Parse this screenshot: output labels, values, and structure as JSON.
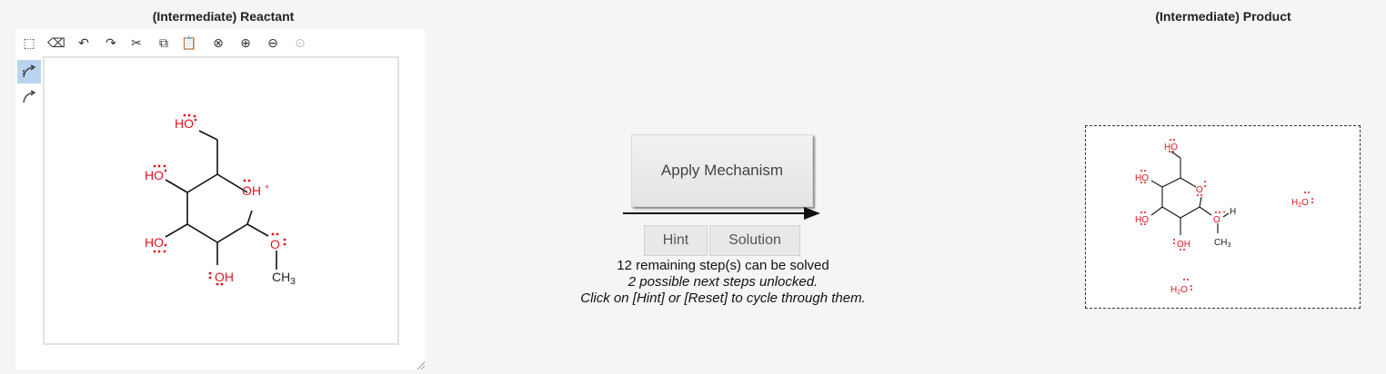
{
  "reactant": {
    "title": "(Intermediate) Reactant"
  },
  "product": {
    "title": "(Intermediate) Product"
  },
  "toolbar": [
    {
      "name": "select-tool-icon",
      "glyph": "⬚"
    },
    {
      "name": "eraser-icon",
      "glyph": "⌫"
    },
    {
      "name": "undo-icon",
      "glyph": "↶"
    },
    {
      "name": "redo-icon",
      "glyph": "↷"
    },
    {
      "name": "cut-icon",
      "glyph": "✂"
    },
    {
      "name": "copy-icon",
      "glyph": "⧉"
    },
    {
      "name": "paste-icon",
      "glyph": "📋"
    },
    {
      "name": "zoom-reset-icon",
      "glyph": "⊗"
    },
    {
      "name": "zoom-in-icon",
      "glyph": "⊕"
    },
    {
      "name": "zoom-out-icon",
      "glyph": "⊖"
    },
    {
      "name": "zoom-fit-icon",
      "glyph": "⊙"
    }
  ],
  "reactant_molecule": {
    "labels": {
      "ho_top": "HO",
      "ho_left_upper": "HO",
      "ho_left_lower": "HO",
      "oh_plus": "OH",
      "plus": "+",
      "o_methoxy": "O",
      "oh_bottom": "OH",
      "ch3": "CH",
      "ch3_sub": "3"
    }
  },
  "product_molecule": {
    "labels": {
      "ho_top": "HO",
      "ho_left_upper": "HO",
      "ho_left_lower": "HO",
      "o_ring": "O",
      "o_plus": "O",
      "plus": "+",
      "h": "H",
      "oh_bottom": "OH",
      "ch3": "CH",
      "ch3_sub": "3",
      "water1_h": "H",
      "water1_sub": "2",
      "water1_o": "O",
      "water2_h": "H",
      "water2_sub": "2",
      "water2_o": "O"
    }
  },
  "actions": {
    "apply_label": "Apply Mechanism",
    "hint_label": "Hint",
    "solution_label": "Solution"
  },
  "status": {
    "line1": "12 remaining step(s) can be solved",
    "line2": "2 possible next steps unlocked.",
    "line3": "Click on [Hint] or [Reset] to cycle through them."
  },
  "colors": {
    "heteroatom": "#e0141e",
    "bond": "#111111",
    "selected_tool": "#b8d4f0"
  }
}
